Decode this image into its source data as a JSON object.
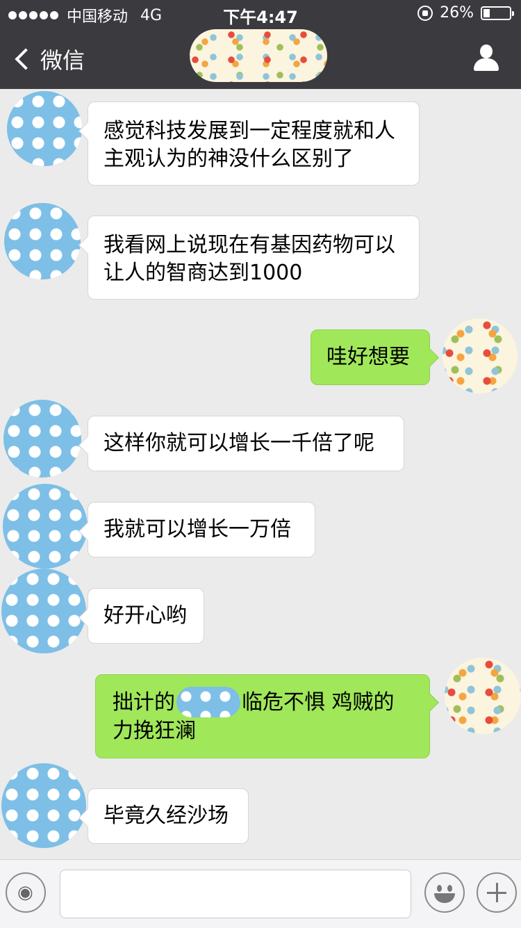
{
  "status_bar": {
    "carrier": "中国移动",
    "network": "4G",
    "time": "下午4:47",
    "battery": "26%",
    "battery_level": 0.26
  },
  "nav": {
    "back_label": "微信"
  },
  "messages": [
    {
      "side": "left",
      "text": "感觉科技发展到一定程度就和人主观认为的神没什么区别了"
    },
    {
      "side": "left",
      "text": "我看网上说现在有基因药物可以让人的智商达到1000"
    },
    {
      "side": "right",
      "text": "哇好想要"
    },
    {
      "side": "left",
      "text": "这样你就可以增长一千倍了呢"
    },
    {
      "side": "left",
      "text": "我就可以增长一万倍"
    },
    {
      "side": "left",
      "text": "好开心哟"
    },
    {
      "side": "right",
      "text_before": "拙计的",
      "text_after": "临危不惧 鸡贼的力挽狂澜"
    },
    {
      "side": "left",
      "text": "毕竟久经沙场"
    }
  ],
  "input_bar": {
    "placeholder": ""
  },
  "colors": {
    "nav_bg": "#3b3a3f",
    "chat_bg": "#ebebeb",
    "sent_bubble": "#a0e75a",
    "received_bubble": "#ffffff"
  }
}
